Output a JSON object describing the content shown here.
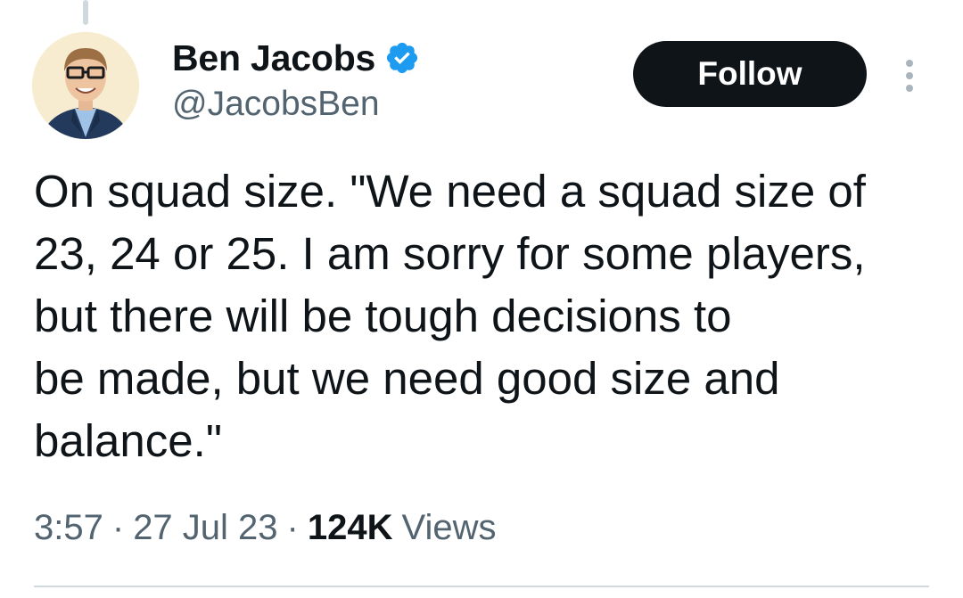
{
  "author": {
    "display_name": "Ben Jacobs",
    "handle": "@JacobsBen",
    "verified": true,
    "verified_color": "#1d9bf0",
    "avatar": "avatar-photo"
  },
  "actions": {
    "follow_label": "Follow",
    "more_icon": "more-vertical-icon"
  },
  "tweet": {
    "lines": [
      "On squad size. \"We need a squad size of",
      "23, 24 or 25. I am sorry for some players,",
      "but there will be tough decisions to",
      "be made, but we need good size and",
      "balance.\""
    ]
  },
  "meta": {
    "time": "3:57",
    "separator": "·",
    "date": "27 Jul 23",
    "views_count": "124K",
    "views_label": "Views"
  },
  "colors": {
    "text_primary": "#0f1419",
    "text_secondary": "#536471",
    "follow_bg": "#0f1419",
    "divider": "#cfd9de"
  }
}
